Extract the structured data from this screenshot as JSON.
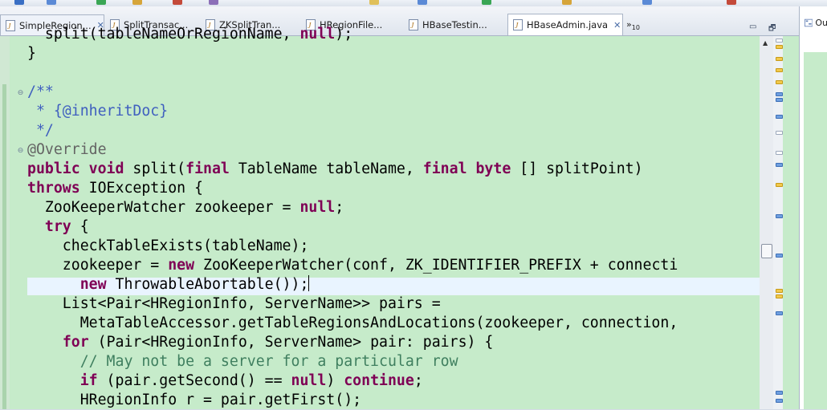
{
  "tabs": [
    {
      "label": "SimpleRegion...",
      "active": false,
      "closable": true,
      "icon": "java-file-icon"
    },
    {
      "label": "SplitTransac...",
      "active": false,
      "closable": false,
      "icon": "java-file-icon"
    },
    {
      "label": "ZKSplitTran...",
      "active": false,
      "closable": false,
      "icon": "java-file-icon"
    },
    {
      "label": "HRegionFile...",
      "active": false,
      "closable": false,
      "icon": "java-file-icon"
    },
    {
      "label": "HBaseTestin...",
      "active": false,
      "closable": false,
      "icon": "java-file-icon"
    },
    {
      "label": "HBaseAdmin.java",
      "active": true,
      "closable": true,
      "icon": "java-file-icon"
    }
  ],
  "more_tabs": {
    "symbol": "»",
    "count": "10"
  },
  "window_controls": {
    "minimize": "▭",
    "maximize": "🗗"
  },
  "right_panel": {
    "tab_label": "Ou"
  },
  "close_symbol": "✕",
  "editor": {
    "lines": [
      "  split(tableNameOrRegionName, null);",
      "}",
      "",
      "/**",
      " * {@inheritDoc}",
      " */",
      "@Override",
      "public void split(final TableName tableName, final byte [] splitPoint)",
      "throws IOException {",
      "  ZooKeeperWatcher zookeeper = null;",
      "  try {",
      "    checkTableExists(tableName);",
      "    zookeeper = new ZooKeeperWatcher(conf, ZK_IDENTIFIER_PREFIX + connecti",
      "      new ThrowableAbortable());",
      "    List<Pair<HRegionInfo, ServerName>> pairs =",
      "      MetaTableAccessor.getTableRegionsAndLocations(zookeeper, connection,",
      "    for (Pair<HRegionInfo, ServerName> pair: pairs) {",
      "      // May not be a server for a particular row",
      "      if (pair.getSecond() == null) continue;",
      "      HRegionInfo r = pair.getFirst();"
    ],
    "current_line": 13
  },
  "colors": {
    "editor_bg": "#c6ebca",
    "keyword": "#7f0055",
    "javadoc": "#3f5fbf",
    "comment": "#3f7f5f",
    "current_line": "#e9f4ff"
  }
}
